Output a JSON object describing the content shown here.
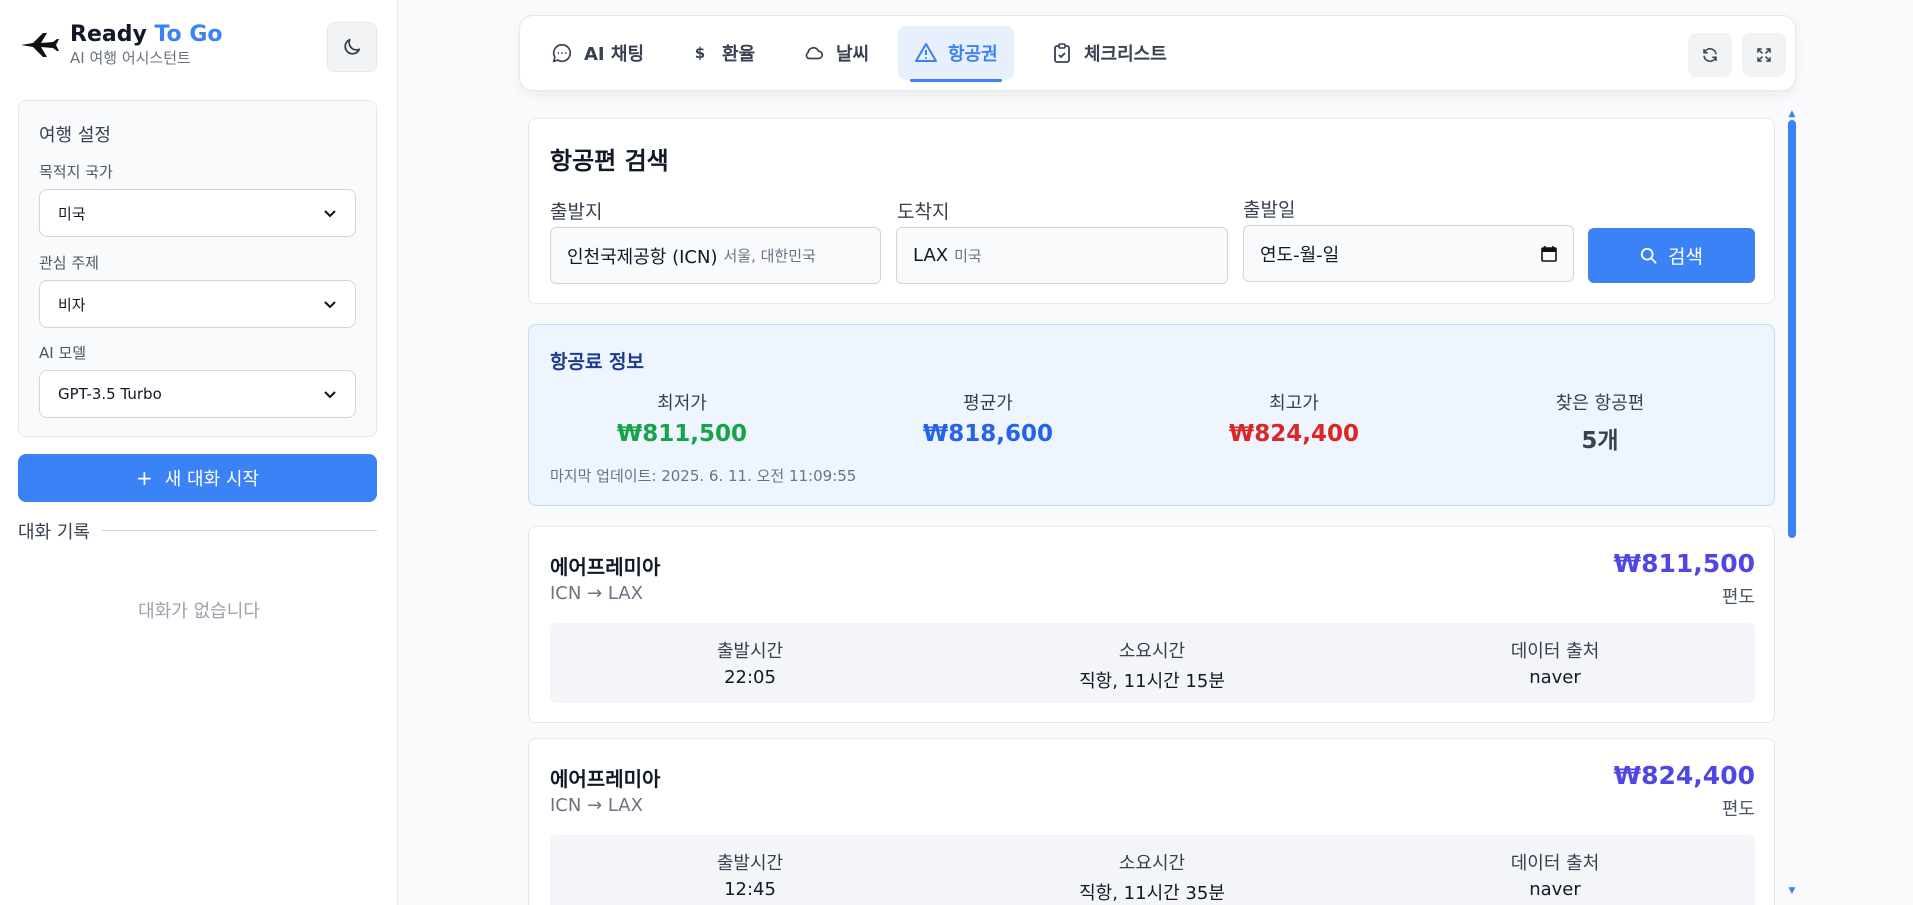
{
  "brand": {
    "title_main": "Ready",
    "title_accent": "To Go",
    "subtitle": "AI 여행 어시스턴트"
  },
  "settings": {
    "title": "여행 설정",
    "country_label": "목적지 국가",
    "country_value": "미국",
    "topic_label": "관심 주제",
    "topic_value": "비자",
    "model_label": "AI 모델",
    "model_value": "GPT-3.5 Turbo"
  },
  "new_chat_label": "새 대화 시작",
  "history": {
    "label": "대화 기록",
    "empty": "대화가 없습니다"
  },
  "tabs": [
    {
      "label": "AI 채팅",
      "icon": "chat-bubble-icon"
    },
    {
      "label": "환율",
      "icon": "dollar-icon"
    },
    {
      "label": "날씨",
      "icon": "cloud-icon"
    },
    {
      "label": "항공권",
      "icon": "warning-triangle-icon"
    },
    {
      "label": "체크리스트",
      "icon": "clipboard-check-icon"
    }
  ],
  "active_tab": "항공권",
  "search": {
    "title": "항공편 검색",
    "origin_label": "출발지",
    "origin_value": "인천국제공항 (ICN)",
    "origin_sub": "서울, 대한민국",
    "dest_label": "도착지",
    "dest_value": "LAX",
    "dest_sub": "미국",
    "date_label": "출발일",
    "date_value": "연도-월-일",
    "button": "검색"
  },
  "price_info": {
    "title": "항공료 정보",
    "min_label": "최저가",
    "min_value": "₩811,500",
    "avg_label": "평균가",
    "avg_value": "₩818,600",
    "max_label": "최고가",
    "max_value": "₩824,400",
    "count_label": "찾은 항공편",
    "count_value": "5개",
    "updated": "마지막 업데이트: 2025. 6. 11. 오전 11:09:55"
  },
  "flights": [
    {
      "airline": "에어프레미아",
      "route": "ICN → LAX",
      "price": "₩811,500",
      "type": "편도",
      "depart_label": "출발시간",
      "depart": "22:05",
      "duration_label": "소요시간",
      "duration": "직항, 11시간 15분",
      "source_label": "데이터 출처",
      "source": "naver"
    },
    {
      "airline": "에어프레미아",
      "route": "ICN → LAX",
      "price": "₩824,400",
      "type": "편도",
      "depart_label": "출발시간",
      "depart": "12:45",
      "duration_label": "소요시간",
      "duration": "직항, 11시간 35분",
      "source_label": "데이터 출처",
      "source": "naver"
    }
  ],
  "colors": {
    "accent": "#3b82f6",
    "min": "#16a34a",
    "avg": "#2563eb",
    "max": "#dc2626",
    "flight_price": "#4f46e5"
  }
}
